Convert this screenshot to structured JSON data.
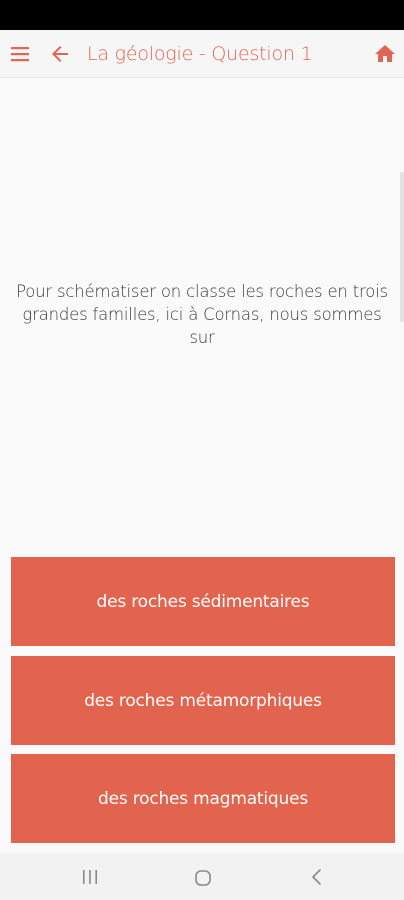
{
  "header": {
    "title": "La géologie - Question 1",
    "icons": {
      "menu": "hamburger-menu-icon",
      "back": "arrow-left-icon",
      "home": "home-icon"
    },
    "accent_color": "#e06552"
  },
  "question": {
    "text": "Pour schématiser on classe les roches en trois grandes familles, ici à Cornas, nous sommes sur"
  },
  "answers": [
    {
      "label": "des roches sédimentaires"
    },
    {
      "label": "des roches métamorphiques"
    },
    {
      "label": "des roches magmatiques"
    }
  ],
  "answer_color": "#e2644f",
  "system_nav": {
    "icons": [
      "recent-apps-icon",
      "home-circle-icon",
      "back-chevron-icon"
    ]
  }
}
